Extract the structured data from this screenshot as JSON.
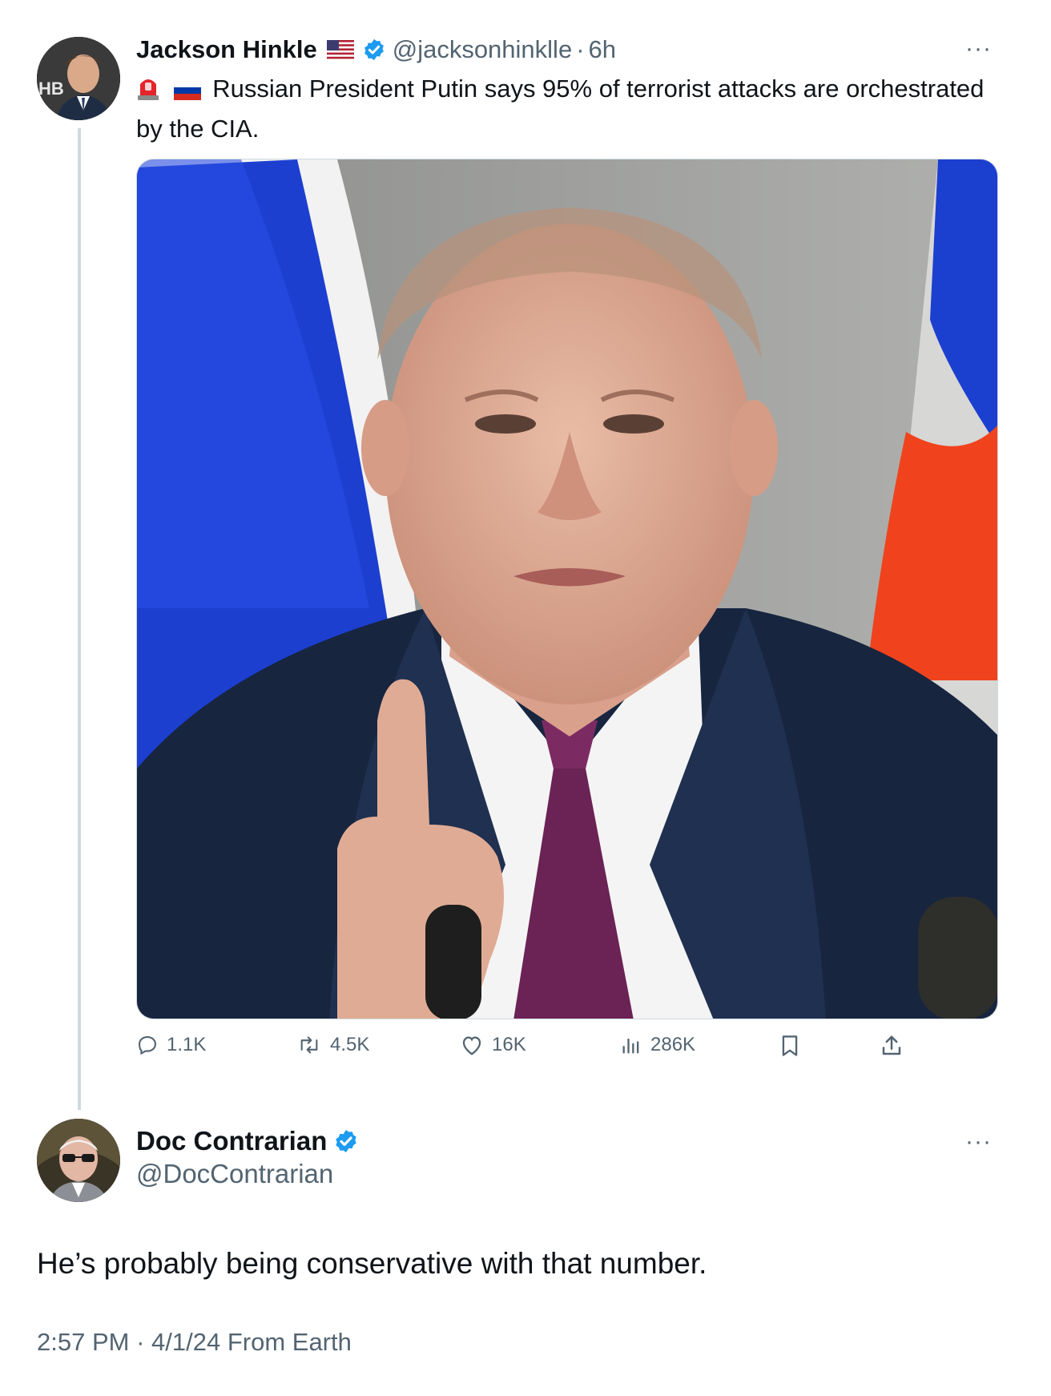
{
  "tweet": {
    "author_name": "Jackson Hinkle",
    "flag_emoji": "us-flag",
    "verified": true,
    "handle": "@jacksonhinklle",
    "separator": "·",
    "time": "6h",
    "more": "···",
    "text_prefix_icons": [
      "police-light-emoji",
      "russia-flag-emoji"
    ],
    "text": "Russian President Putin says 95% of terrorist attacks are orchestrated by the CIA.",
    "image_icon": "photo-putin",
    "actions": {
      "replies": "1.1K",
      "reposts": "4.5K",
      "likes": "16K",
      "views": "286K"
    }
  },
  "reply": {
    "author_name": "Doc Contrarian",
    "verified": true,
    "handle": "@DocContrarian",
    "more": "···",
    "text": "He’s probably being conservative with that number.",
    "time": "2:57 PM",
    "separator": "·",
    "date_source": "4/1/24 From Earth"
  },
  "colors": {
    "text": "#0f1419",
    "secondary": "#536471",
    "verified": "#1d9bf0",
    "thread_line": "#cfd9de"
  }
}
